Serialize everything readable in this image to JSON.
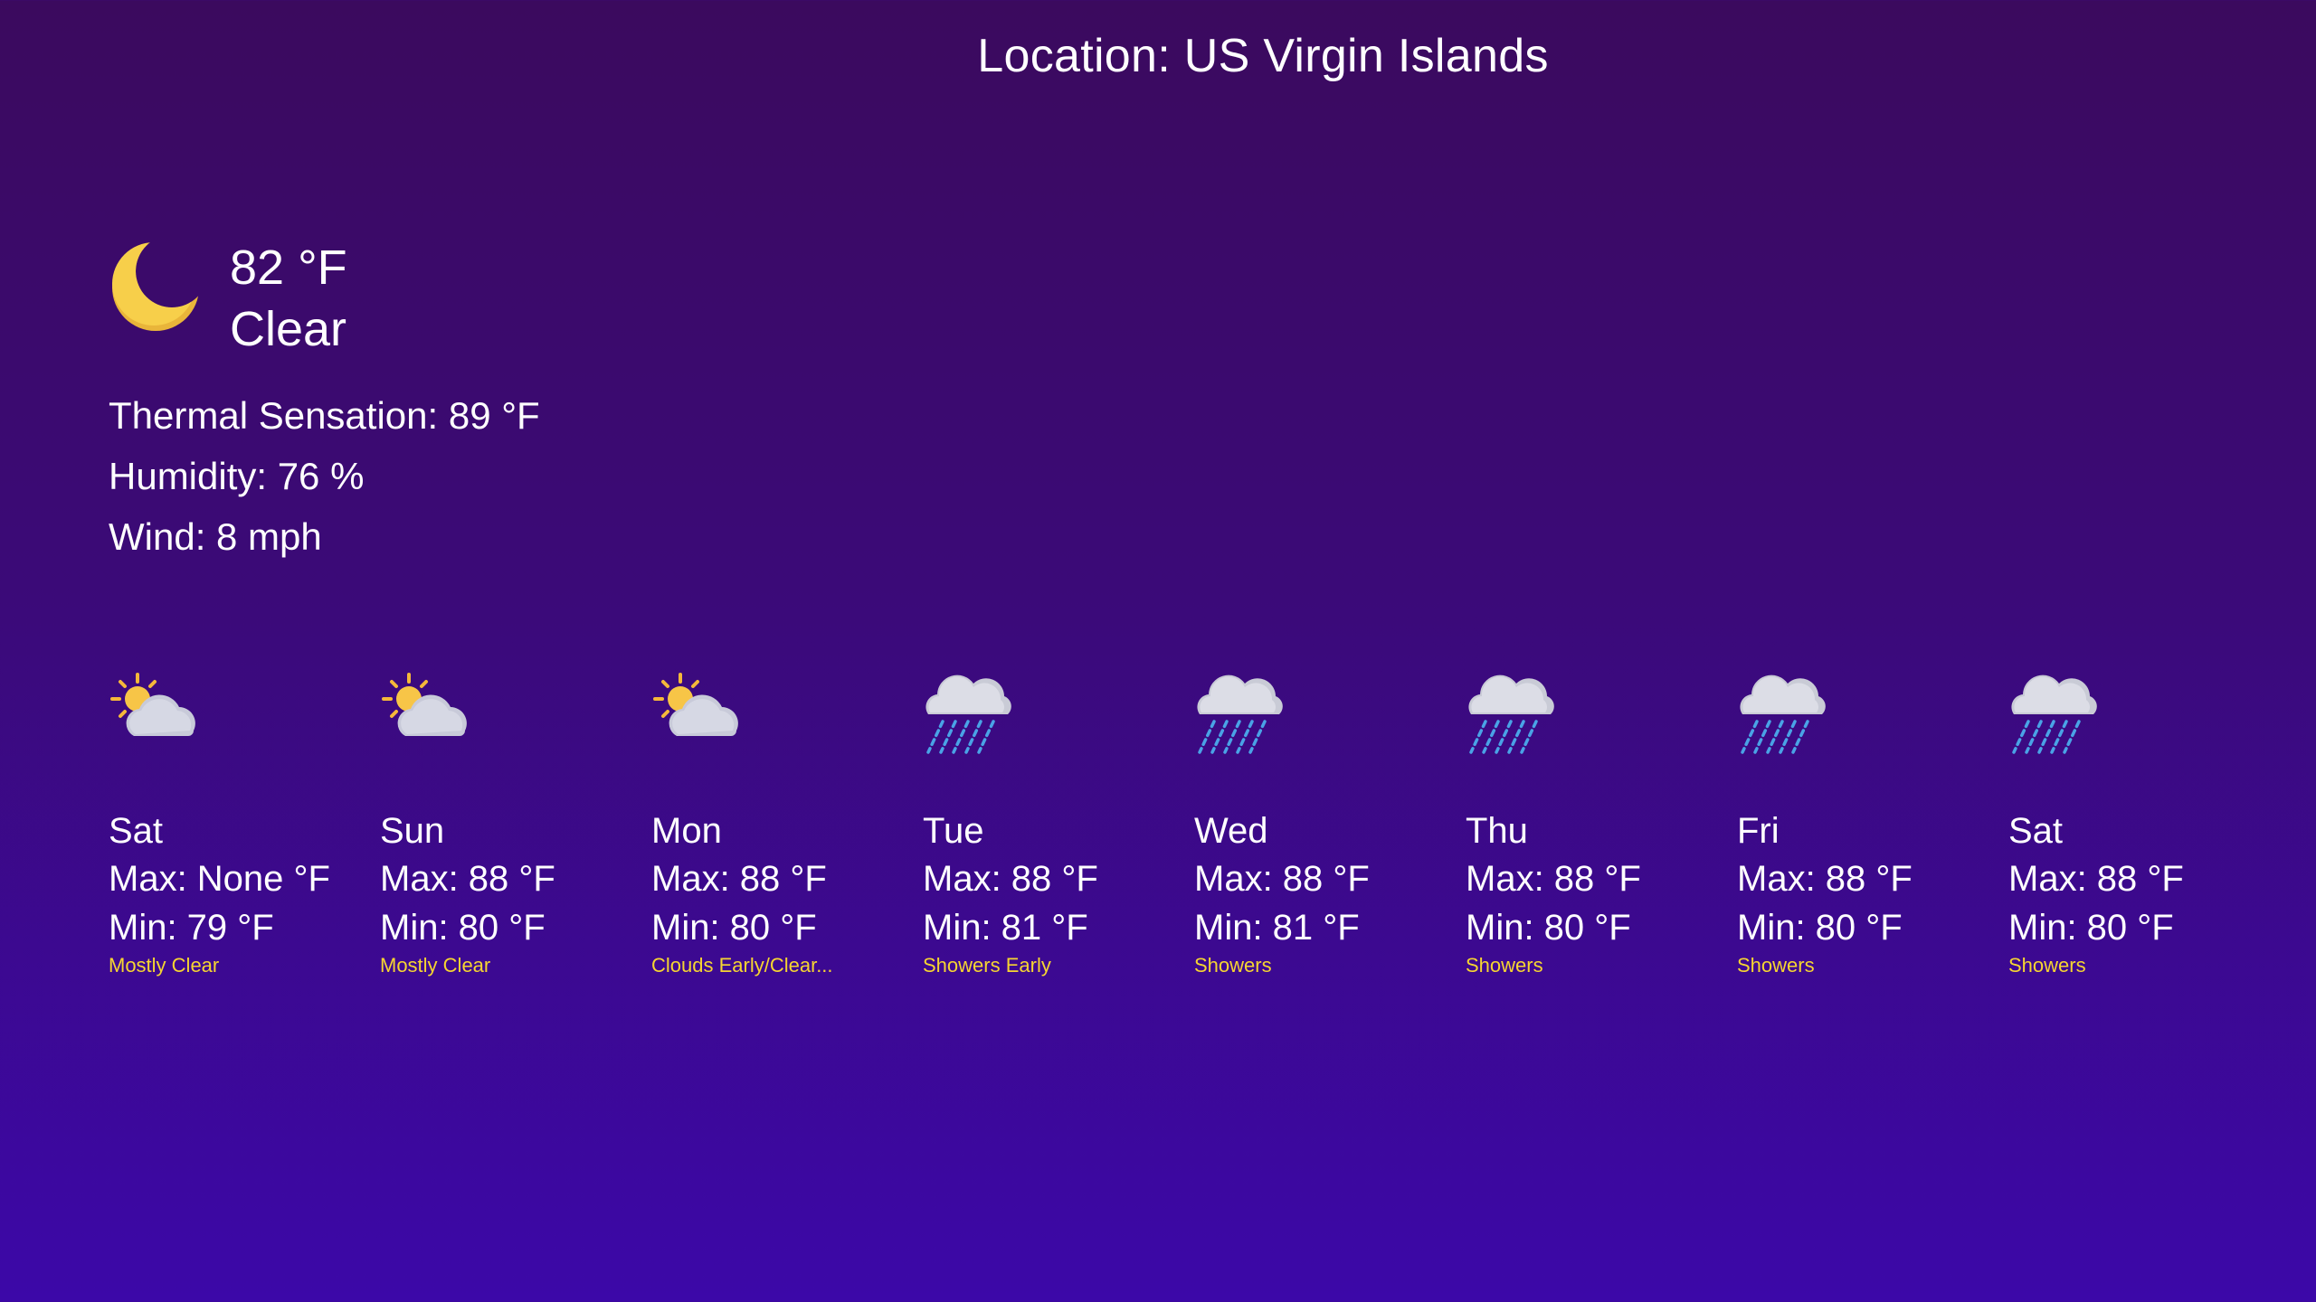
{
  "location": "Location: US Virgin Islands",
  "current": {
    "icon": "moon-icon",
    "temperature": "82 °F",
    "condition": "Clear",
    "thermal_sensation": "Thermal Sensation: 89 °F",
    "humidity": "Humidity: 76 %",
    "wind": "Wind: 8 mph"
  },
  "forecast": [
    {
      "day": "Sat",
      "max": "Max: None °F",
      "min": "Min: 79 °F",
      "condition": "Mostly Clear",
      "icon": "partly-cloudy-icon"
    },
    {
      "day": "Sun",
      "max": "Max: 88 °F",
      "min": "Min: 80 °F",
      "condition": "Mostly Clear",
      "icon": "partly-cloudy-icon"
    },
    {
      "day": "Mon",
      "max": "Max: 88 °F",
      "min": "Min: 80 °F",
      "condition": "Clouds Early/Clear...",
      "icon": "partly-cloudy-icon"
    },
    {
      "day": "Tue",
      "max": "Max: 88 °F",
      "min": "Min: 81 °F",
      "condition": "Showers Early",
      "icon": "rain-cloud-icon"
    },
    {
      "day": "Wed",
      "max": "Max: 88 °F",
      "min": "Min: 81 °F",
      "condition": "Showers",
      "icon": "rain-cloud-icon"
    },
    {
      "day": "Thu",
      "max": "Max: 88 °F",
      "min": "Min: 80 °F",
      "condition": "Showers",
      "icon": "rain-cloud-icon"
    },
    {
      "day": "Fri",
      "max": "Max: 88 °F",
      "min": "Min: 80 °F",
      "condition": "Showers",
      "icon": "rain-cloud-icon"
    },
    {
      "day": "Sat",
      "max": "Max: 88 °F",
      "min": "Min: 80 °F",
      "condition": "Showers",
      "icon": "rain-cloud-icon"
    }
  ],
  "colors": {
    "condition_text": "#f6d531",
    "moon": "#f6c945",
    "sun": "#f7c547",
    "cloud": "#d3d5e2",
    "rain": "#4aa3e6"
  }
}
